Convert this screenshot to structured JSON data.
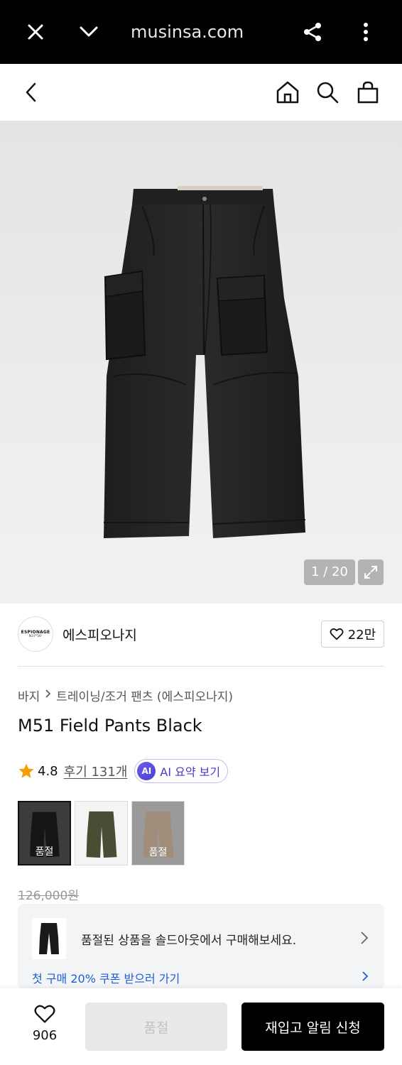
{
  "browser": {
    "url": "musinsa.com",
    "icons": [
      "close-icon",
      "chevron-down-icon",
      "share-icon",
      "more-vert-icon"
    ]
  },
  "header": {
    "icons": [
      "back-icon",
      "home-icon",
      "search-icon",
      "shopping-bag-icon"
    ]
  },
  "gallery": {
    "counter": "1 / 20"
  },
  "brand": {
    "logo_line1": "ESPIONAGE",
    "logo_line2": "N37°56'",
    "name": "에스피오나지",
    "likes": "22만"
  },
  "breadcrumb": {
    "category": "바지",
    "separator": ">",
    "subcategory": "트레이닝/조거 팬츠 (에스피오나지)"
  },
  "product": {
    "title": "M51 Field Pants Black",
    "rating": "4.8",
    "reviews": "후기 131개",
    "ai_badge": "AI",
    "ai_summary": "AI 요약 보기",
    "original_price": "126,000원"
  },
  "swatches": [
    {
      "color": "#1f1f1f",
      "bg": "#3a3a3a",
      "label": "품절",
      "selected": true,
      "soldout": true
    },
    {
      "color": "#4a4d33",
      "bg": "#f4f4f4",
      "label": "",
      "selected": false,
      "soldout": false
    },
    {
      "color": "#b7a48e",
      "bg": "#9a9a9a",
      "label": "품절",
      "selected": false,
      "soldout": true
    }
  ],
  "banner": {
    "text": "품절된 상품을 솔드아웃에서 구매해보세요.",
    "second_line": "첫 구매 20% 쿠폰 받으러 가기"
  },
  "bottom_bar": {
    "wish_count": "906",
    "soldout_label": "품절",
    "restock_label": "재입고 알림 신청"
  },
  "colors": {
    "accent_purple": "#4a39c9",
    "star": "#f59e0b",
    "link_blue": "#1d5ed8"
  }
}
